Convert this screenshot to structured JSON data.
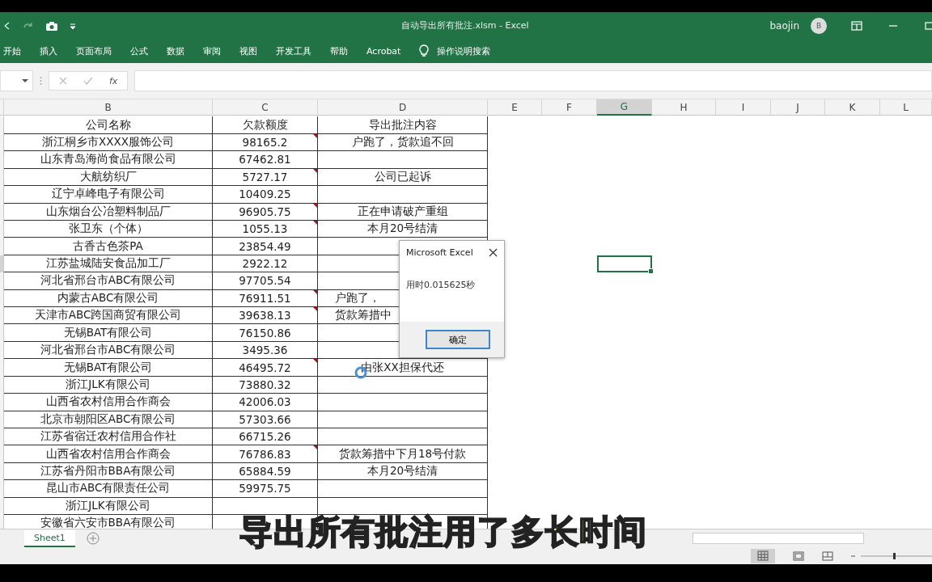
{
  "title_bar": {
    "title": "自动导出所有批注.xlsm  -  Excel",
    "user": "baojin",
    "avatar": "B"
  },
  "ribbon_tabs": [
    {
      "label": "开始",
      "selected": false
    },
    {
      "label": "插入",
      "selected": false
    },
    {
      "label": "页面布局",
      "selected": false
    },
    {
      "label": "公式",
      "selected": false
    },
    {
      "label": "数据",
      "selected": false
    },
    {
      "label": "审阅",
      "selected": false
    },
    {
      "label": "视图",
      "selected": false
    },
    {
      "label": "开发工具",
      "selected": false
    },
    {
      "label": "帮助",
      "selected": false
    },
    {
      "label": "Acrobat",
      "selected": false
    }
  ],
  "tell_me": "操作说明搜索",
  "formula_bar": {
    "fx": "fx"
  },
  "columns": [
    {
      "label": "B",
      "selected": false
    },
    {
      "label": "C",
      "selected": false
    },
    {
      "label": "D",
      "selected": false
    },
    {
      "label": "E",
      "selected": false
    },
    {
      "label": "F",
      "selected": false
    },
    {
      "label": "G",
      "selected": true
    },
    {
      "label": "H",
      "selected": false
    },
    {
      "label": "I",
      "selected": false
    },
    {
      "label": "J",
      "selected": false
    },
    {
      "label": "K",
      "selected": false
    },
    {
      "label": "L",
      "selected": false
    }
  ],
  "table": {
    "header": [
      "公司名称",
      "欠款额度",
      "导出批注内容"
    ],
    "rows": [
      {
        "company": "浙江桐乡市XXXX服饰公司",
        "amount": "98165.2",
        "note": "户跑了，货款追不回",
        "comment": true,
        "selected": false
      },
      {
        "company": "山东青岛海尚食品有限公司",
        "amount": "67462.81",
        "comment": false,
        "selected": false
      },
      {
        "company": "大航纺织厂",
        "amount": "5727.17",
        "note": "公司已起诉",
        "comment": true,
        "selected": false
      },
      {
        "company": "辽宁卓峰电子有限公司",
        "amount": "10409.25",
        "comment": false,
        "selected": false
      },
      {
        "company": "山东烟台公冶塑料制品厂",
        "amount": "96905.75",
        "note": "正在申请破产重组",
        "comment": true,
        "selected": false
      },
      {
        "company": "张卫东（个体）",
        "amount": "1055.13",
        "note": "本月20号结清",
        "comment": true,
        "selected": false
      },
      {
        "company": "古香古色茶PA",
        "amount": "23854.49",
        "comment": false,
        "selected": false
      },
      {
        "company": "江苏盐城陆安食品加工厂",
        "amount": "2922.12",
        "comment": false,
        "selected": true
      },
      {
        "company": "河北省邢台市ABC有限公司",
        "amount": "97705.54",
        "comment": false,
        "selected": false
      },
      {
        "company": "内蒙古ABC有限公司",
        "amount": "76911.51",
        "note": "户跑了，",
        "note_cut": true,
        "comment": true,
        "selected": false
      },
      {
        "company": "天津市ABC跨国商贸有限公司",
        "amount": "39638.13",
        "note": "货款筹措中",
        "note_cut": true,
        "comment": true,
        "selected": false
      },
      {
        "company": "无锡BAT有限公司",
        "amount": "76150.86",
        "comment": false,
        "selected": false
      },
      {
        "company": "河北省邢台市ABC有限公司",
        "amount": "3495.36",
        "comment": false,
        "selected": false
      },
      {
        "company": "无锡BAT有限公司",
        "amount": "46495.72",
        "note": "由张XX担保代还",
        "comment": true,
        "selected": false
      },
      {
        "company": "浙江JLK有限公司",
        "amount": "73880.32",
        "comment": false,
        "selected": false
      },
      {
        "company": "山西省农村信用合作商会",
        "amount": "42006.03",
        "comment": false,
        "selected": false
      },
      {
        "company": "北京市朝阳区ABC有限公司",
        "amount": "57303.66",
        "comment": false,
        "selected": false
      },
      {
        "company": "江苏省宿迁农村信用合作社",
        "amount": "66715.26",
        "comment": false,
        "selected": false
      },
      {
        "company": "山西省农村信用合作商会",
        "amount": "76786.83",
        "note": "货款筹措中下月18号付款",
        "comment": true,
        "selected": false
      },
      {
        "company": "江苏省丹阳市BBA有限公司",
        "amount": "65884.59",
        "note": "本月20号结清",
        "comment": false,
        "selected": false
      },
      {
        "company": "昆山市ABC有限责任公司",
        "amount": "59975.75",
        "comment": false,
        "selected": false
      },
      {
        "company": "浙江JLK有限公司",
        "comment": false,
        "selected": false
      },
      {
        "company": "安徽省六安市BBA有限公司",
        "comment": false,
        "selected": false
      }
    ]
  },
  "dialog": {
    "title": "Microsoft Excel",
    "message": "用时0.015625秒",
    "button": "确定"
  },
  "sheet_tabs": [
    {
      "label": "Sheet1",
      "selected": true
    }
  ],
  "caption": "导出所有批注用了多长时间"
}
